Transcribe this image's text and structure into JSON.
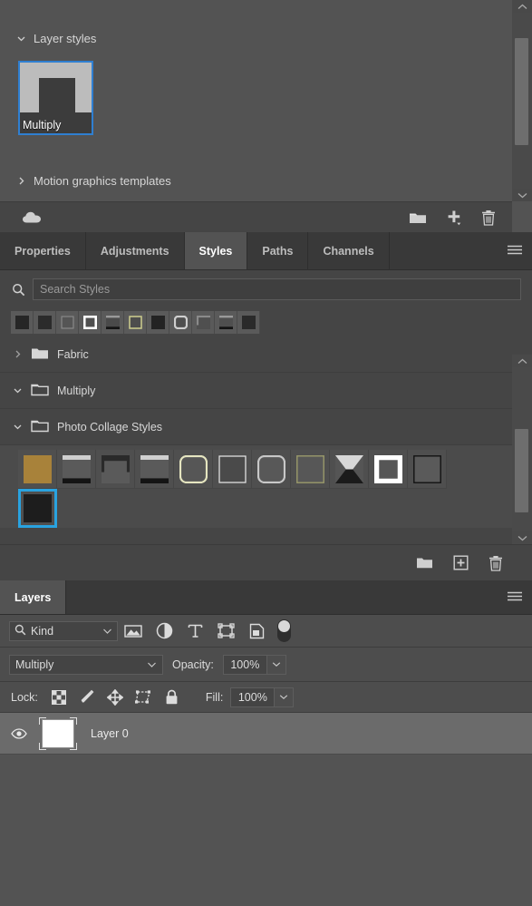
{
  "colors": {
    "panel_bg": "#535353",
    "panel_alt_bg": "#454545",
    "tabbar_bg": "#393939",
    "selection_blue": "#2f7fd1",
    "selection_cyan": "#29a3e0",
    "row_highlight": "#6b6b6b",
    "text": "#d4d4d4"
  },
  "libraries": {
    "sections": [
      {
        "label": "Layer styles",
        "expanded": true,
        "twisty": "chevron-down-icon"
      },
      {
        "label": "Motion graphics templates",
        "expanded": false,
        "twisty": "chevron-right-icon"
      }
    ],
    "asset": {
      "label": "Multiply",
      "selected": true
    },
    "footer_icons": [
      {
        "name": "cloud-icon",
        "position": "left"
      },
      {
        "name": "new-group-icon",
        "position": "right"
      },
      {
        "name": "add-content-icon",
        "position": "right"
      },
      {
        "name": "delete-icon",
        "position": "right"
      }
    ],
    "scrollbar": {
      "up": "chevron-up-icon",
      "down": "chevron-down-icon"
    }
  },
  "styles_panel": {
    "tabs": [
      {
        "label": "Properties",
        "active": false
      },
      {
        "label": "Adjustments",
        "active": false
      },
      {
        "label": "Styles",
        "active": true
      },
      {
        "label": "Paths",
        "active": false
      },
      {
        "label": "Channels",
        "active": false
      }
    ],
    "menu_icon": "panel-menu-icon",
    "search": {
      "placeholder": "Search Styles",
      "value": "",
      "icon": "search-icon"
    },
    "preset_strip": [
      {
        "fill": "#262626",
        "border": "#3d3d3d",
        "kind": "solid"
      },
      {
        "fill": "#2b2b2b",
        "border": "#3d3d3d",
        "kind": "solid"
      },
      {
        "fill": "#555555",
        "border": "#8a8a8a",
        "kind": "outline"
      },
      {
        "fill": "#4f4f4f",
        "border": "#ffffff",
        "kind": "outline-thick"
      },
      {
        "fill": "#4a4a4a",
        "border": "#9a9a9a",
        "kind": "shadow-bottom"
      },
      {
        "fill": "#4d4d4d",
        "border": "#c9c98e",
        "kind": "outline-gold"
      },
      {
        "fill": "#232323",
        "border": "#3a3a3a",
        "kind": "solid"
      },
      {
        "fill": "#4f4f4f",
        "border": "#cfcfcf",
        "kind": "outline-round"
      },
      {
        "fill": "#4f4f4f",
        "border": "#8a8a8a",
        "kind": "top-left-corner"
      },
      {
        "fill": "#4f4f4f",
        "border": "#9a9a9a",
        "kind": "shadow-bottom"
      },
      {
        "fill": "#2a2a2a",
        "border": "#3a3a3a",
        "kind": "solid"
      }
    ],
    "tree": [
      {
        "label": "Fabric",
        "expanded": false,
        "twisty": "chevron-right-icon",
        "icon": "folder-closed-icon"
      },
      {
        "label": "Multiply",
        "expanded": true,
        "twisty": "chevron-down-icon",
        "icon": "folder-open-icon"
      },
      {
        "label": "Photo Collage Styles",
        "expanded": true,
        "twisty": "chevron-down-icon",
        "icon": "folder-open-icon"
      }
    ],
    "swatches_row1": [
      {
        "kind": "gold-fill",
        "fill": "#a8823a",
        "border": "#a8823a"
      },
      {
        "kind": "top-light-bottom-dark",
        "fill": "#5a5a5a",
        "border": "#cfcfcf"
      },
      {
        "kind": "top-dark",
        "fill": "#5a5a5a",
        "border": "#2a2a2a"
      },
      {
        "kind": "top-light-bottom-black",
        "fill": "#5a5a5a",
        "border": "#d0d0d0"
      },
      {
        "kind": "gold-round-outline",
        "fill": "#565656",
        "border": "#e5e5c0"
      },
      {
        "kind": "thin-white-outline",
        "fill": "#4a4a4a",
        "border": "#e0e0e0"
      },
      {
        "kind": "grey-round-outline",
        "fill": "#585858",
        "border": "#c8c8c8"
      },
      {
        "kind": "olive-outline",
        "fill": "#575757",
        "border": "#9a9a6a"
      },
      {
        "kind": "hourglass-shadow",
        "fill": "#555555",
        "border": "#d8d8d8"
      },
      {
        "kind": "white-thick-outline",
        "fill": "#565656",
        "border": "#ffffff"
      },
      {
        "kind": "black-thin-outline",
        "fill": "#5a5a5a",
        "border": "#111111"
      }
    ],
    "swatches_row2": [
      {
        "kind": "black-fill",
        "fill": "#1d1d1d",
        "border": "#1d1d1d",
        "selected": true
      }
    ],
    "footer_icons": [
      {
        "name": "new-group-icon"
      },
      {
        "name": "create-new-style-icon"
      },
      {
        "name": "delete-style-icon"
      }
    ],
    "scrollbar": {
      "up": "chevron-up-icon",
      "down": "chevron-down-icon"
    }
  },
  "layers_panel": {
    "tabs": [
      {
        "label": "Layers",
        "active": true
      }
    ],
    "menu_icon": "panel-menu-icon",
    "filter": {
      "kind_label": "Kind",
      "search_icon": "search-icon",
      "chevron": "chevron-down-icon",
      "icons": [
        {
          "name": "filter-pixel-icon"
        },
        {
          "name": "filter-adjustment-icon"
        },
        {
          "name": "filter-type-icon"
        },
        {
          "name": "filter-shape-icon"
        },
        {
          "name": "filter-smart-object-icon"
        }
      ],
      "toggle": {
        "name": "filter-enable-toggle",
        "on": false
      }
    },
    "blend": {
      "mode": "Multiply",
      "opacity_label": "Opacity:",
      "opacity_value": "100%",
      "chevron": "chevron-down-icon"
    },
    "lock": {
      "label": "Lock:",
      "icons": [
        {
          "name": "lock-transparent-pixels-icon"
        },
        {
          "name": "lock-image-pixels-icon"
        },
        {
          "name": "lock-position-icon"
        },
        {
          "name": "lock-artboard-nesting-icon"
        },
        {
          "name": "lock-all-icon"
        }
      ],
      "fill_label": "Fill:",
      "fill_value": "100%"
    },
    "layers": [
      {
        "name": "Layer 0",
        "visible": true,
        "selected": true,
        "thumbnail": "white",
        "eye_icon": "eye-icon"
      }
    ]
  }
}
